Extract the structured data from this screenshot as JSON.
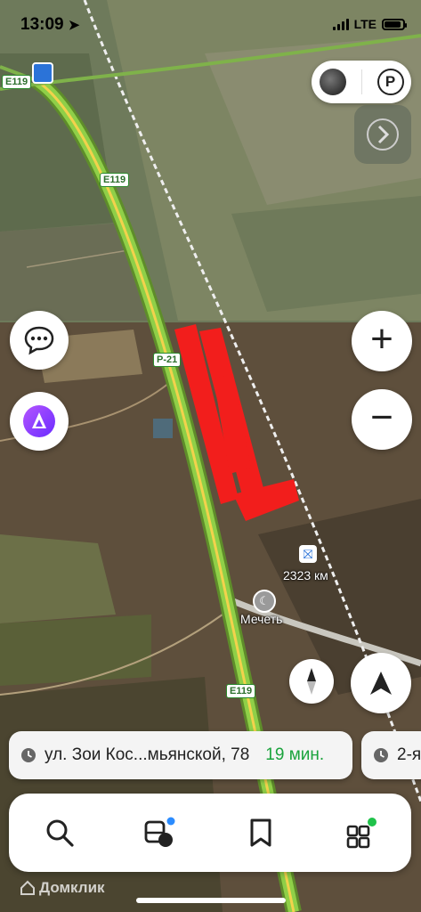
{
  "status_bar": {
    "time": "13:09",
    "network": "LTE"
  },
  "map": {
    "road_labels": [
      "E119",
      "E119",
      "P-21",
      "E119"
    ],
    "poi": {
      "distance": "2323 км",
      "mosque": "Мечеть"
    },
    "watermark": "Домклик"
  },
  "top_controls": {
    "layers_icon": "layers-circle-icon",
    "parking_label": "P"
  },
  "side_controls": {
    "chat_icon": "chat-bubble-icon",
    "alice_icon": "alice-assistant-icon",
    "zoom_in": "+",
    "zoom_out": "−"
  },
  "route_cards": [
    {
      "address": "ул. Зои Кос...мьянской, 78",
      "eta": "19 мин."
    },
    {
      "address": "2-я"
    }
  ],
  "bottom_nav": [
    {
      "name": "search",
      "icon": "search-icon"
    },
    {
      "name": "transport",
      "icon": "transport-icon"
    },
    {
      "name": "bookmarks",
      "icon": "bookmark-icon"
    },
    {
      "name": "services",
      "icon": "services-grid-icon"
    }
  ],
  "colors": {
    "route_green": "#7fc13a",
    "highlight_red": "#ff1a1a",
    "eta_green": "#1aa33c"
  }
}
